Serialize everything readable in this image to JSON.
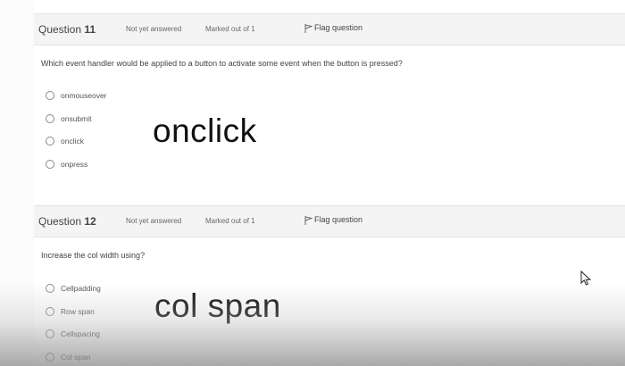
{
  "questions": [
    {
      "number_label": "Question",
      "number": "11",
      "status": "Not yet answered",
      "marks": "Marked out of 1",
      "flag_label": "Flag question",
      "text": "Which event handler would be applied to a button to activate some event when the button is pressed?",
      "options": [
        "onmouseover",
        "onsubmit",
        "onclick",
        "onpress"
      ],
      "handwritten_answer": "onclick"
    },
    {
      "number_label": "Question",
      "number": "12",
      "status": "Not yet answered",
      "marks": "Marked out of 1",
      "flag_label": "Flag question",
      "text": "Increase the col width using?",
      "options": [
        "Cellpadding",
        "Row span",
        "Cellspacing",
        "Col span"
      ],
      "handwritten_answer": "col span"
    }
  ],
  "icons": {
    "flag": "flag-icon",
    "radio": "radio-icon",
    "cursor": "mouse-cursor-icon"
  }
}
